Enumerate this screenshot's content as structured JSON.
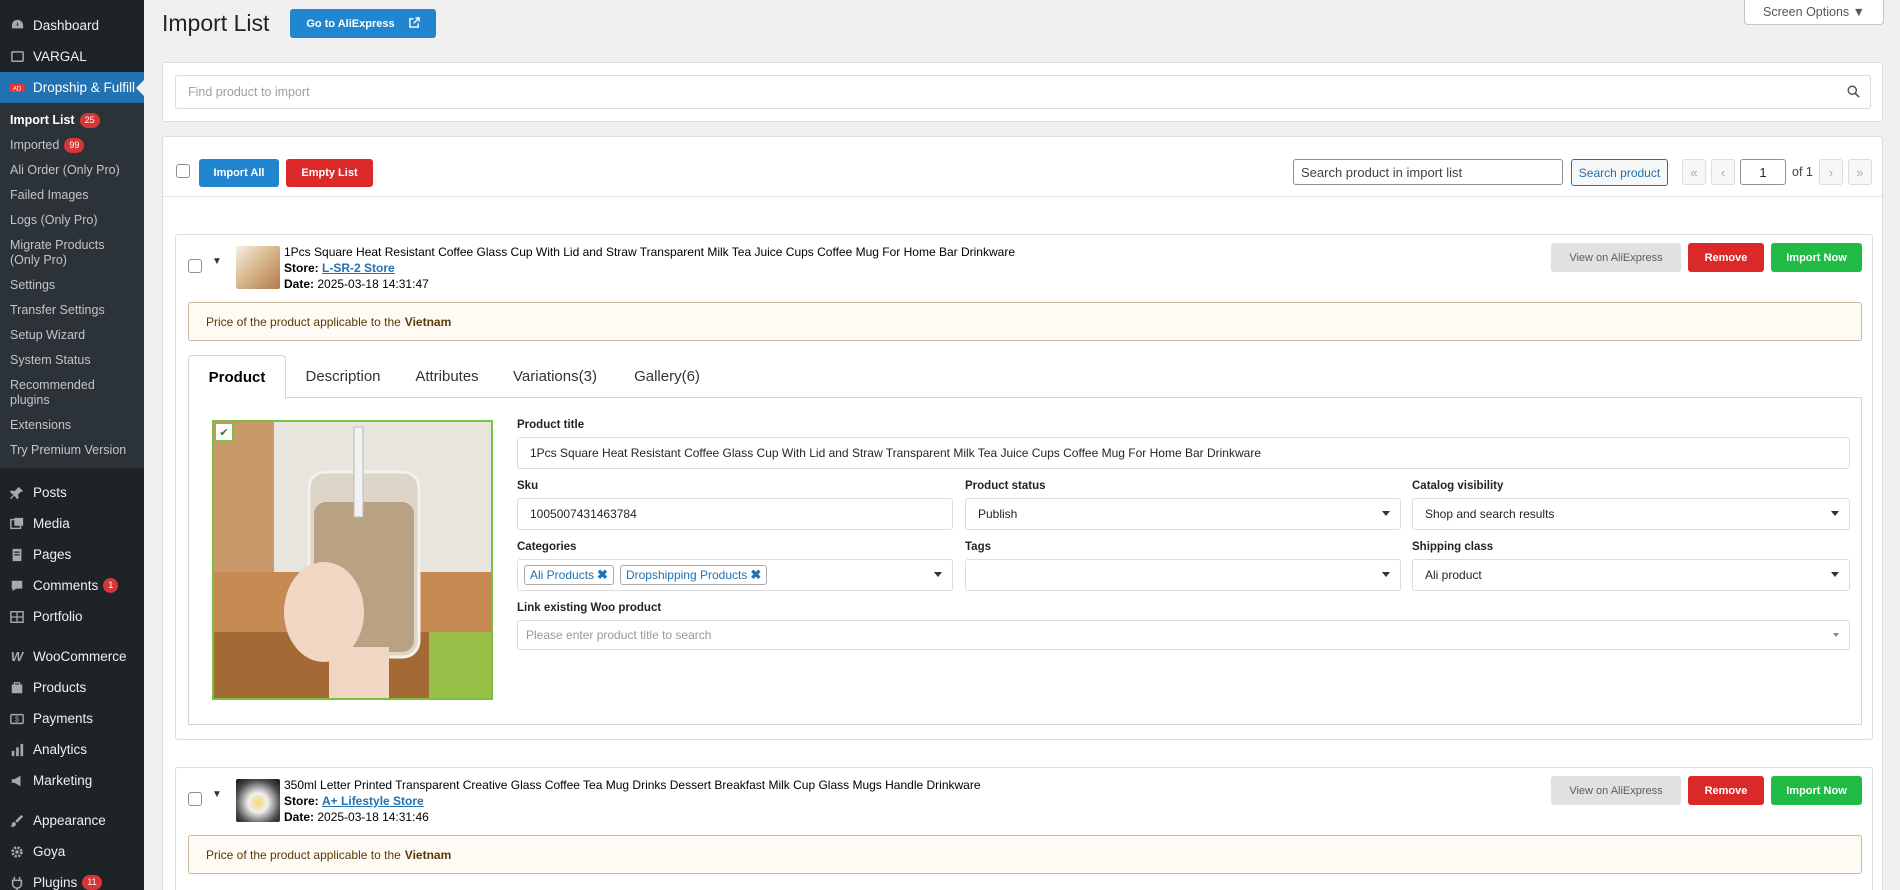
{
  "sidebar": {
    "menu_top": [
      {
        "label": "Dashboard",
        "icon": "dashboard-icon"
      },
      {
        "label": "VARGAL",
        "icon": "vargal-icon"
      },
      {
        "label": "Dropship & Fulfill",
        "icon": "dropship-icon"
      }
    ],
    "submenu": [
      {
        "label": "Import List",
        "badge": "25"
      },
      {
        "label": "Imported",
        "badge": "99"
      },
      {
        "label": "Ali Order (Only Pro)"
      },
      {
        "label": "Failed Images"
      },
      {
        "label": "Logs (Only Pro)"
      },
      {
        "label": "Migrate Products (Only Pro)"
      },
      {
        "label": "Settings"
      },
      {
        "label": "Transfer Settings"
      },
      {
        "label": "Setup Wizard"
      },
      {
        "label": "System Status"
      },
      {
        "label": "Recommended plugins"
      },
      {
        "label": "Extensions"
      },
      {
        "label": "Try Premium Version"
      }
    ],
    "menu_bottom": [
      {
        "label": "Posts",
        "icon": "pin-icon"
      },
      {
        "label": "Media",
        "icon": "media-icon"
      },
      {
        "label": "Pages",
        "icon": "pages-icon"
      },
      {
        "label": "Comments",
        "icon": "comment-icon",
        "badge": "1"
      },
      {
        "label": "Portfolio",
        "icon": "portfolio-icon"
      },
      {
        "label": "WooCommerce",
        "icon": "woo-icon"
      },
      {
        "label": "Products",
        "icon": "products-icon"
      },
      {
        "label": "Payments",
        "icon": "payments-icon"
      },
      {
        "label": "Analytics",
        "icon": "analytics-icon"
      },
      {
        "label": "Marketing",
        "icon": "marketing-icon"
      },
      {
        "label": "Appearance",
        "icon": "brush-icon"
      },
      {
        "label": "Goya",
        "icon": "gear-icon"
      },
      {
        "label": "Plugins",
        "icon": "plugin-icon",
        "badge": "11"
      }
    ]
  },
  "header": {
    "title": "Import List",
    "goto_label": "Go to AliExpress",
    "screen_options": "Screen Options ▼"
  },
  "search": {
    "placeholder": "Find product to import"
  },
  "toolbar": {
    "import_all": "Import All",
    "empty_list": "Empty List",
    "search_placeholder": "Search product in import list",
    "search_button": "Search product",
    "page": "1",
    "of": "of 1",
    "first": "«",
    "prev": "‹",
    "next": "›",
    "last": "»"
  },
  "products": [
    {
      "title": "1Pcs Square Heat Resistant Coffee Glass Cup With Lid and Straw Transparent Milk Tea Juice Cups Coffee Mug For Home Bar Drinkware",
      "store_label": "Store:",
      "store": "L-SR-2 Store",
      "date_label": "Date:",
      "date": "2025-03-18 14:31:47",
      "view_label": "View on AliExpress",
      "remove_label": "Remove",
      "import_label": "Import Now",
      "notice_text": "Price of the product applicable to the",
      "notice_country": "Vietnam",
      "tabs": [
        "Product",
        "Description",
        "Attributes",
        "Variations(3)",
        "Gallery(6)"
      ],
      "form": {
        "title_label": "Product title",
        "title_value": "1Pcs Square Heat Resistant Coffee Glass Cup With Lid and Straw Transparent Milk Tea Juice Cups Coffee Mug For Home Bar Drinkware",
        "sku_label": "Sku",
        "sku_value": "1005007431463784",
        "status_label": "Product status",
        "status_value": "Publish",
        "visibility_label": "Catalog visibility",
        "visibility_value": "Shop and search results",
        "categories_label": "Categories",
        "categories": [
          "Ali Products",
          "Dropshipping Products"
        ],
        "tags_label": "Tags",
        "tags_value": "",
        "shipping_label": "Shipping class",
        "shipping_value": "Ali product",
        "link_label": "Link existing Woo product",
        "link_placeholder": "Please enter product title to search"
      }
    },
    {
      "title": "350ml Letter Printed Transparent Creative Glass Coffee Tea Mug Drinks Dessert Breakfast Milk Cup Glass Mugs Handle Drinkware",
      "store_label": "Store:",
      "store": "A+ Lifestyle Store",
      "date_label": "Date:",
      "date": "2025-03-18 14:31:46",
      "view_label": "View on AliExpress",
      "remove_label": "Remove",
      "import_label": "Import Now",
      "notice_text": "Price of the product applicable to the",
      "notice_country": "Vietnam"
    }
  ],
  "colors": {
    "sidebar_bg": "#1d2327",
    "active": "#2271b1",
    "blue": "#2185d0",
    "red": "#db2828",
    "green": "#21ba45"
  }
}
